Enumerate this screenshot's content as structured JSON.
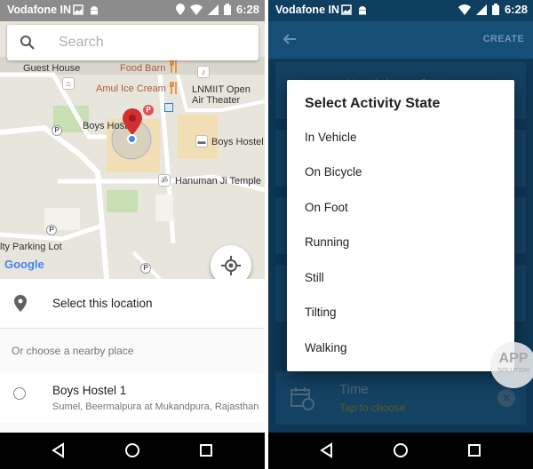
{
  "left_screen": {
    "status": {
      "carrier": "Vodafone IN",
      "time": "6:28"
    },
    "search": {
      "placeholder": "Search"
    },
    "map_labels": {
      "guest_house": "Guest House",
      "food_barn": "Food Barn",
      "amul_ice_cream": "Amul Ice Cream",
      "lnmiit_line1": "LNMIIT Open",
      "lnmiit_line2": "Air Theater",
      "boys_hostel_1": "Boys Hostel",
      "boys_hostel_2": "Boys Hostel",
      "hanuman_temple": "Hanuman Ji Temple",
      "parking_lot": "lty Parking Lot",
      "google_logo": "Google"
    },
    "select_location": {
      "label": "Select this location"
    },
    "nearby_header": "Or choose a nearby place",
    "places": [
      {
        "name": "Boys Hostel 1",
        "address": "Sumel, Beermalpura at Mukandpura, Rajasthan"
      }
    ]
  },
  "right_screen": {
    "status": {
      "carrier": "Vodafone IN",
      "time": "6:28"
    },
    "toolbar": {
      "create_label": "CREATE"
    },
    "cards": {
      "first_title": "Headphone State"
    },
    "time_card": {
      "title": "Time",
      "subtitle": "Tap to choose"
    },
    "dialog": {
      "title": "Select Activity State",
      "options": [
        "In Vehicle",
        "On Bicycle",
        "On Foot",
        "Running",
        "Still",
        "Tilting",
        "Walking"
      ]
    }
  },
  "watermark": {
    "line1": "APP",
    "line2": "SOLUTION"
  },
  "colors": {
    "primary_dark": "#0e3f61",
    "primary": "#154f78",
    "card": "#1e5f8e",
    "map_pin": "#d32f2f",
    "location_dot": "#4285f4"
  }
}
